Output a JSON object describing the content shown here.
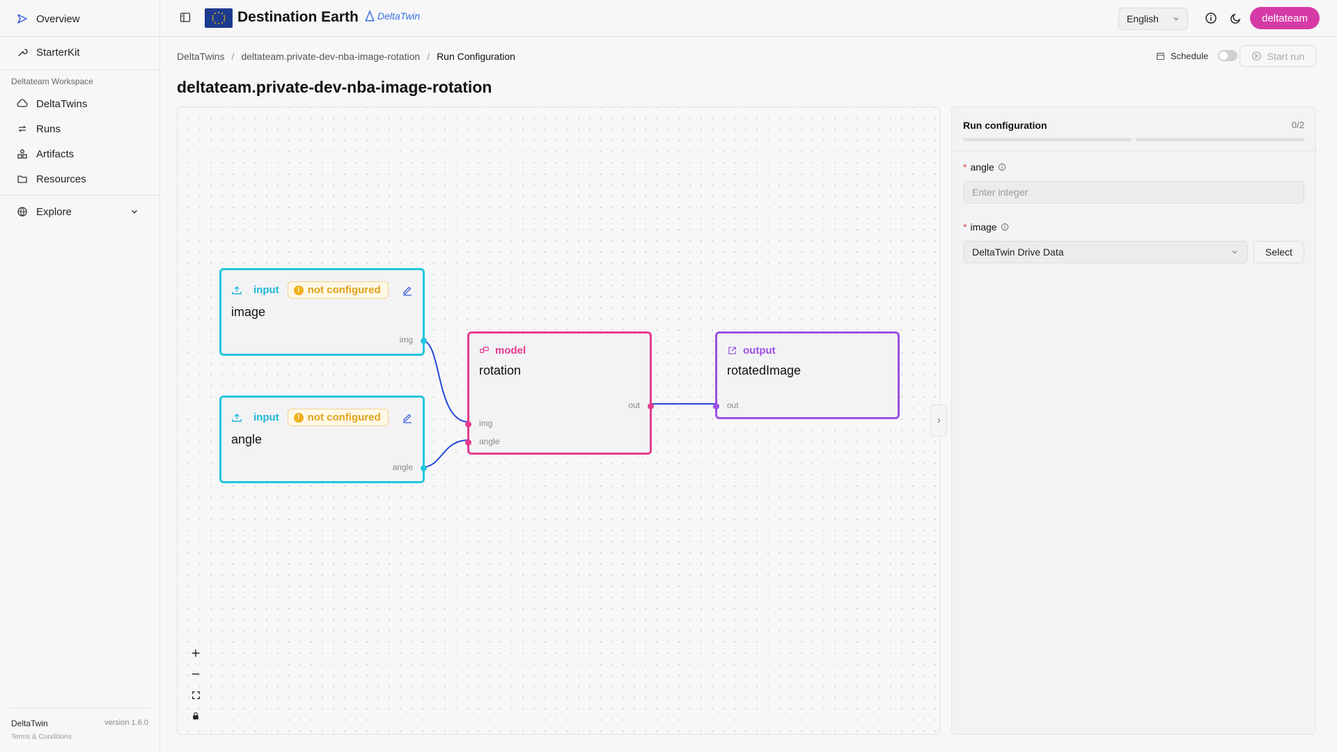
{
  "sidebar": {
    "overview": "Overview",
    "starterkit": "StarterKit",
    "workspace_title": "Deltateam Workspace",
    "items": [
      {
        "label": "DeltaTwins",
        "icon": "cloud-icon"
      },
      {
        "label": "Runs",
        "icon": "repeat-icon"
      },
      {
        "label": "Artifacts",
        "icon": "shapes-icon"
      },
      {
        "label": "Resources",
        "icon": "folder-icon"
      }
    ],
    "explore": "Explore",
    "footer": {
      "name": "DeltaTwin",
      "version": "version 1.6.0",
      "terms": "Terms & Conditions"
    }
  },
  "header": {
    "brand": "Destination Earth",
    "logo_text": "DeltaTwin",
    "language": "English",
    "user": "deltateam"
  },
  "breadcrumb": [
    "DeltaTwins",
    "deltateam.private-dev-nba-image-rotation",
    "Run Configuration"
  ],
  "toolbar": {
    "schedule": "Schedule",
    "start_run": "Start run"
  },
  "page_title": "deltateam.private-dev-nba-image-rotation",
  "graph": {
    "nodes": {
      "image": {
        "type": "input",
        "status": "not configured",
        "name": "image",
        "port": "img"
      },
      "angle": {
        "type": "input",
        "status": "not configured",
        "name": "angle",
        "port": "angle"
      },
      "rotation": {
        "type": "model",
        "name": "rotation",
        "out_port": "out",
        "in_ports": [
          "img",
          "angle"
        ]
      },
      "rotatedImage": {
        "type": "output",
        "name": "rotatedImage",
        "port": "out"
      }
    },
    "colors": {
      "input": "#22c5df",
      "model": "#e63b8f",
      "output": "#9b4fe0",
      "edge": "#2448d8"
    }
  },
  "config": {
    "title": "Run configuration",
    "count": "0/2",
    "fields": [
      {
        "label": "angle",
        "placeholder": "Enter integer"
      },
      {
        "label": "image",
        "value": "DeltaTwin Drive Data",
        "button": "Select"
      }
    ]
  }
}
